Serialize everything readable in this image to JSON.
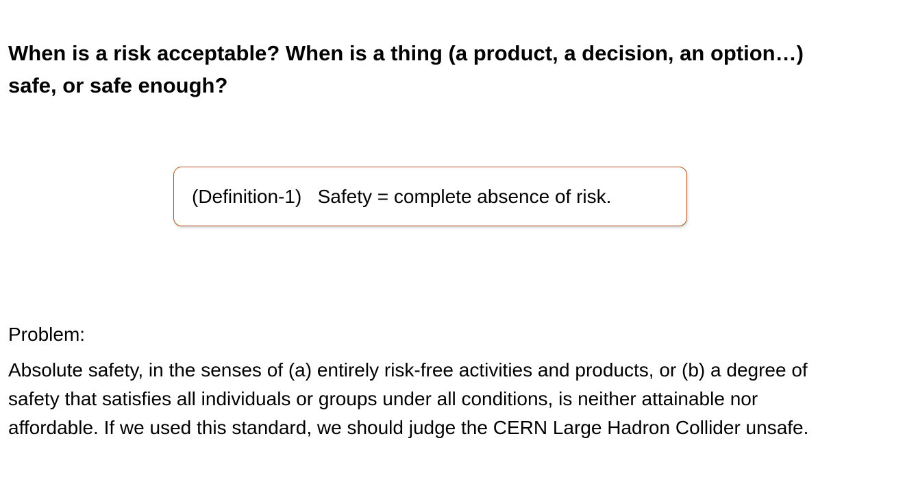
{
  "title": "When is a risk acceptable? When is a thing (a product, a decision, an option…) safe, or safe enough?",
  "definition": {
    "label": "(Definition-1)",
    "text": "Safety = complete absence of risk."
  },
  "problem": {
    "label": "Problem:",
    "body": "Absolute safety, in the senses of (a) entirely risk-free activities and products, or (b) a degree of safety that satisfies all individuals or groups under all conditions, is neither attainable nor affordable. If we used this standard, we should judge the CERN Large Hadron Collider unsafe."
  },
  "colors": {
    "box_border": "#b5541c",
    "text": "#000000",
    "background": "#ffffff"
  }
}
